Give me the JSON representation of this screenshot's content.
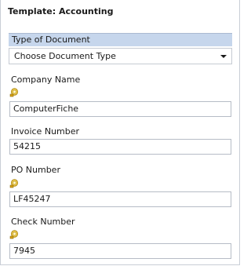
{
  "template": {
    "title": "Template: Accounting"
  },
  "document_type": {
    "header": "Type of Document",
    "selected": "Choose Document Type"
  },
  "fields": [
    {
      "label": "Company Name",
      "value": "ComputerFiche",
      "has_lookup": true,
      "icon": "lookup-icon"
    },
    {
      "label": "Invoice Number",
      "value": "54215",
      "has_lookup": false
    },
    {
      "label": "PO Number",
      "value": "LF45247",
      "has_lookup": true,
      "icon": "lookup-icon"
    },
    {
      "label": "Check Number",
      "value": "7945",
      "has_lookup": true,
      "icon": "lookup-icon"
    }
  ],
  "colors": {
    "header_bg": "#c6d6ec",
    "lookup_gold": "#e8b923"
  }
}
